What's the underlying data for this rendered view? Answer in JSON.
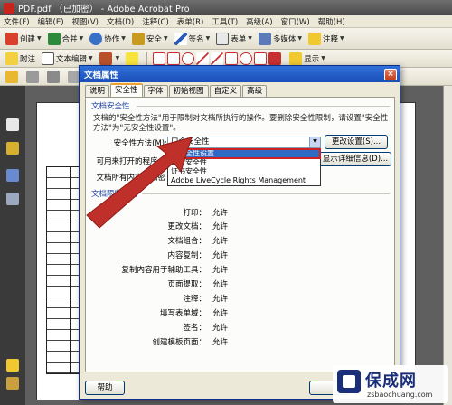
{
  "app": {
    "title": "PDF.pdf （已加密） - Adobe Acrobat Pro"
  },
  "menubar": [
    "文件(F)",
    "编辑(E)",
    "视图(V)",
    "文档(D)",
    "注释(C)",
    "表单(R)",
    "工具(T)",
    "高级(A)",
    "窗口(W)",
    "帮助(H)"
  ],
  "toolbar1": {
    "create": "创建",
    "combine": "合并",
    "collaborate": "协作",
    "secure": "安全",
    "sign": "签名",
    "forms": "表单",
    "multimedia": "多媒体",
    "comment": "注释"
  },
  "toolbar2": {
    "attach": "附注",
    "text_edit": "文本编辑",
    "show": "显示"
  },
  "icons": {
    "create": "create-icon",
    "combine": "combine-icon",
    "collaborate": "collaborate-icon",
    "secure": "lock-icon",
    "sign": "pen-icon",
    "forms": "form-icon",
    "multimedia": "multimedia-icon",
    "comment": "comment-icon"
  },
  "colors": {
    "title_bar": "#1b4fb8",
    "selection": "#316ac5",
    "highlight_outline": "#d02020",
    "arrow": "#c0302a"
  },
  "dialog": {
    "title": "文档属性",
    "tabs": [
      "说明",
      "安全性",
      "字体",
      "初始视图",
      "自定义",
      "高级"
    ],
    "active_tab": "安全性",
    "group_title": "文档安全性",
    "description": "文档的\"安全性方法\"用于限制对文档所执行的操作。要删除安全性限制，请设置\"安全性方法\"为\"无安全性设置\"。",
    "method_label": "安全性方法(M):",
    "method_value": "口令安全性",
    "change_settings_button": "更改设置(S)...",
    "open_with_label": "可用来打开的程序：",
    "show_details_button": "显示详细信息(D)...",
    "all_content_label": "文档所有内容均加密",
    "dropdown_options": [
      "无安全性设置",
      "口令安全性",
      "证书安全性",
      "Adobe LiveCycle Rights Management"
    ],
    "dropdown_selected": "无安全性设置",
    "restrictions_title": "文档限制小结",
    "restrictions": [
      {
        "key": "打印：",
        "value": "允许"
      },
      {
        "key": "更改文档：",
        "value": "允许"
      },
      {
        "key": "文档组合：",
        "value": "允许"
      },
      {
        "key": "内容复制：",
        "value": "允许"
      },
      {
        "key": "复制内容用于辅助工具：",
        "value": "允许"
      },
      {
        "key": "页面提取：",
        "value": "允许"
      },
      {
        "key": "注释：",
        "value": "允许"
      },
      {
        "key": "填写表单域：",
        "value": "允许"
      },
      {
        "key": "签名：",
        "value": "允许"
      },
      {
        "key": "创建模板页面：",
        "value": "允许"
      }
    ],
    "help_button": "帮助"
  },
  "watermark": {
    "brand": "保成网",
    "url": "zsbaochuang.com"
  }
}
